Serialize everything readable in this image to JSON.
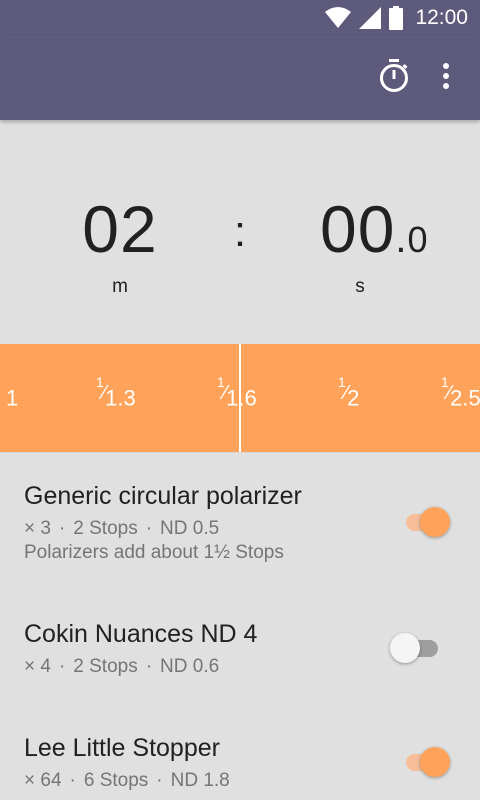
{
  "status_bar": {
    "time": "12:00",
    "icons": [
      "wifi-icon",
      "signal-icon",
      "battery-icon"
    ]
  },
  "app_bar": {
    "actions": [
      "timer-icon",
      "more-options-icon"
    ],
    "color": "#5d5a7b"
  },
  "timer": {
    "minutes": "02",
    "minutes_unit": "m",
    "separator": ":",
    "seconds": "00",
    "decimal_point": ".",
    "seconds_fraction": "0",
    "seconds_unit": "s"
  },
  "aperture": {
    "color": "#ffa35a",
    "stops": [
      {
        "numerator": "",
        "slash": "",
        "denominator": "1"
      },
      {
        "numerator": "1",
        "slash": "⁄",
        "denominator": "1.3"
      },
      {
        "numerator": "1",
        "slash": "⁄",
        "denominator": "1.6"
      },
      {
        "numerator": "1",
        "slash": "⁄",
        "denominator": "2"
      },
      {
        "numerator": "1",
        "slash": "⁄",
        "denominator": "2.5"
      }
    ]
  },
  "filters": [
    {
      "name": "Generic circular polarizer",
      "factor": "× 3",
      "stops": "2 Stops",
      "nd": "ND 0.5",
      "note": "Polarizers add about 1½ Stops",
      "separator": "·",
      "enabled": true
    },
    {
      "name": "Cokin Nuances ND 4",
      "factor": "× 4",
      "stops": "2 Stops",
      "nd": "ND 0.6",
      "separator": "·",
      "enabled": false
    },
    {
      "name": "Lee Little Stopper",
      "factor": "× 64",
      "stops": "6 Stops",
      "nd": "ND 1.8",
      "separator": "·",
      "enabled": true
    }
  ]
}
